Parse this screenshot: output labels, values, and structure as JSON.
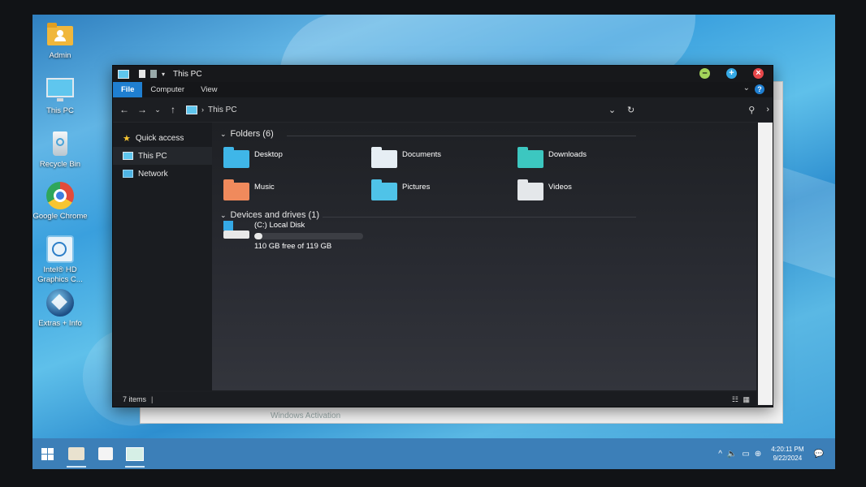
{
  "desktop": {
    "icons": [
      {
        "label": "Admin",
        "icon": "user-folder-icon"
      },
      {
        "label": "This PC",
        "icon": "monitor-icon"
      },
      {
        "label": "Recycle Bin",
        "icon": "recycle-bin-icon"
      },
      {
        "label": "Google Chrome",
        "icon": "chrome-icon"
      },
      {
        "label": "Intel® HD Graphics C...",
        "icon": "intel-graphics-icon"
      },
      {
        "label": "Extras + Info",
        "icon": "extras-info-icon"
      }
    ]
  },
  "ghost_window": {
    "watermark": "Windows Activation"
  },
  "window": {
    "title": "This PC",
    "ribbon_tabs": [
      "File",
      "Computer",
      "View"
    ],
    "active_tab": "File",
    "address": {
      "breadcrumb": "This PC"
    },
    "sidebar": [
      {
        "label": "Quick access",
        "icon": "star-icon"
      },
      {
        "label": "This PC",
        "icon": "monitor-icon"
      },
      {
        "label": "Network",
        "icon": "network-icon"
      }
    ],
    "folders_header": "Folders (6)",
    "folders": [
      {
        "name": "Desktop",
        "color": "#3fb6e8"
      },
      {
        "name": "Documents",
        "color": "#e6eef4"
      },
      {
        "name": "Downloads",
        "color": "#3cc7c0"
      },
      {
        "name": "Music",
        "color": "#f08a5c"
      },
      {
        "name": "Pictures",
        "color": "#4fc3e8"
      },
      {
        "name": "Videos",
        "color": "#e4e7ea"
      }
    ],
    "devices_header": "Devices and drives (1)",
    "drives": [
      {
        "name": "(C:) Local Disk",
        "free": "110 GB free of 119 GB",
        "used_fraction": 0.076
      }
    ],
    "status": {
      "items": "7 items"
    }
  },
  "taskbar": {
    "apps": [
      "start-icon",
      "file-explorer-icon",
      "store-icon",
      "control-panel-icon"
    ],
    "time": "4:20:11 PM",
    "date": "9/22/2024"
  },
  "colors": {
    "accent": "#1f7fd1",
    "window_bg": "#1c1e22"
  }
}
